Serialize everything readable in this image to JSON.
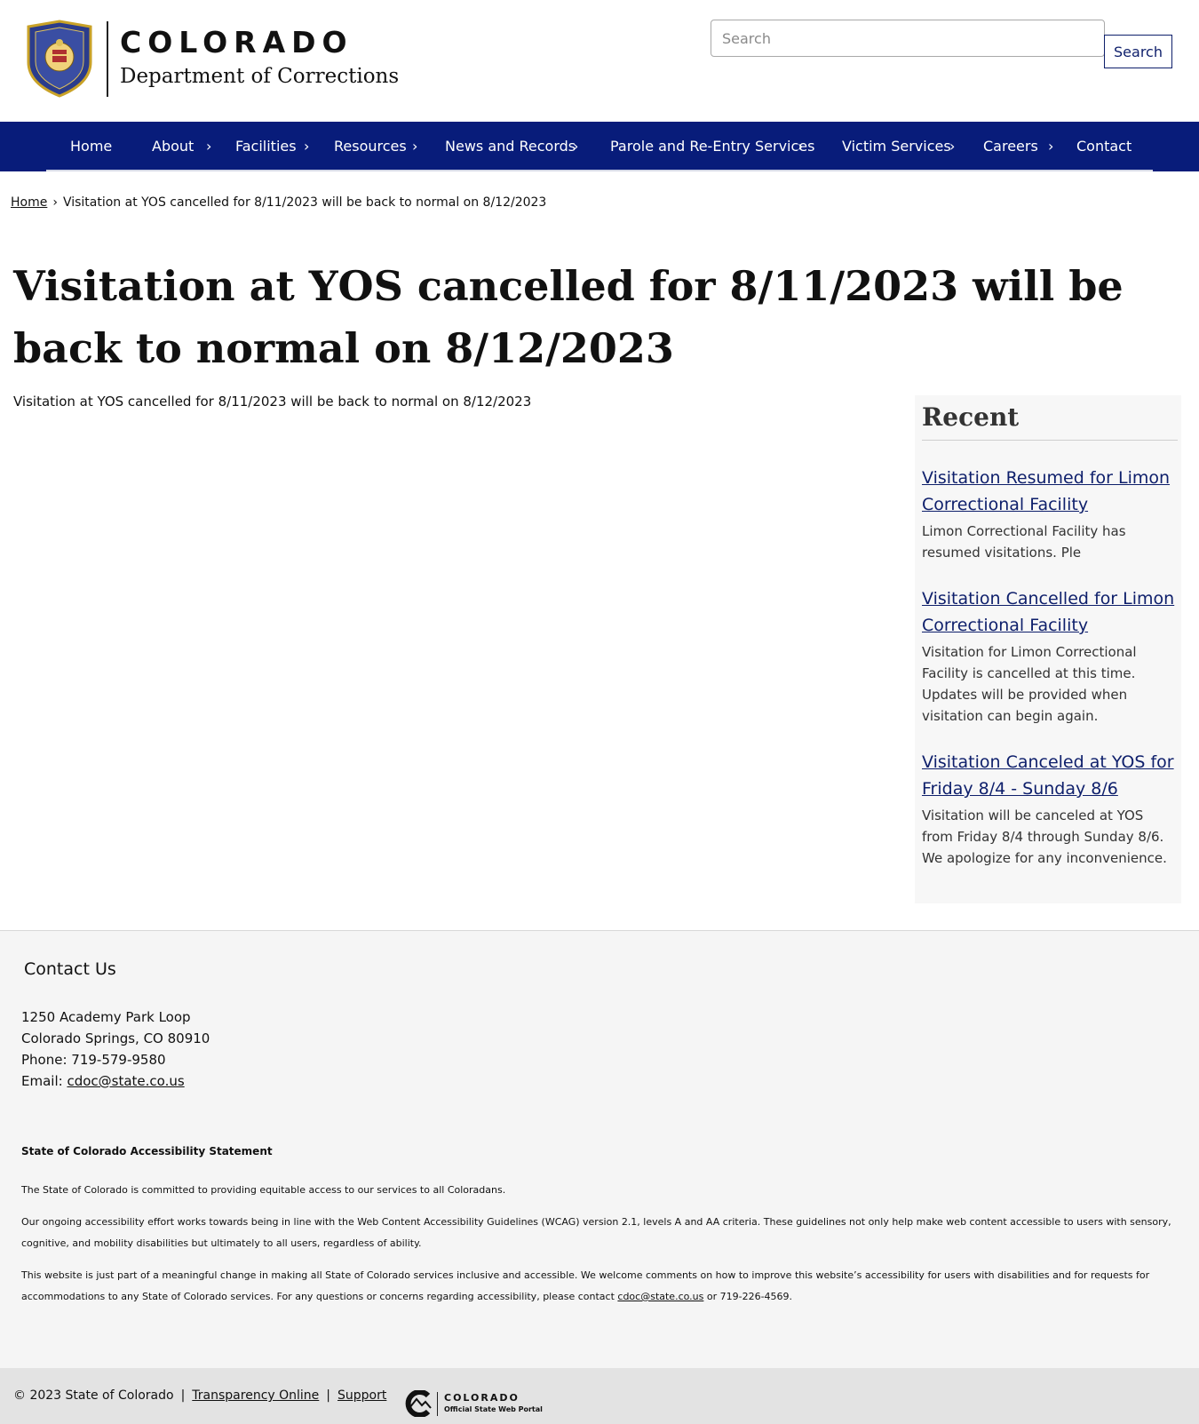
{
  "header": {
    "brand_name": "COLORADO",
    "department": "Department of Corrections",
    "search_placeholder": "Search",
    "search_button": "Search"
  },
  "nav": {
    "items": [
      {
        "label": "Home"
      },
      {
        "label": "About"
      },
      {
        "label": "Facilities"
      },
      {
        "label": "Resources"
      },
      {
        "label": "News and Records"
      },
      {
        "label": "Parole and Re-Entry Services"
      },
      {
        "label": "Victim Services"
      },
      {
        "label": "Careers"
      },
      {
        "label": "Contact"
      }
    ],
    "chevron": "›"
  },
  "breadcrumb": {
    "home": "Home",
    "separator": "›",
    "current": "Visitation at YOS cancelled for 8/11/2023 will be back to normal on 8/12/2023"
  },
  "article": {
    "title": "Visitation at YOS cancelled for 8/11/2023 will be back to normal on 8/12/2023",
    "body": "Visitation at YOS cancelled for 8/11/2023 will be back to normal on 8/12/2023"
  },
  "recent": {
    "heading": "Recent",
    "items": [
      {
        "title": "Visitation Resumed for Limon Correctional Facility",
        "desc": "Limon Correctional Facility has resumed visitations.  Ple"
      },
      {
        "title": "Visitation Cancelled for Limon Correctional Facility",
        "desc": "Visitation for Limon Correctional Facility is cancelled at this time. Updates will be provided when visitation can begin again."
      },
      {
        "title": "Visitation Canceled at YOS for Friday 8/4 - Sunday 8/6",
        "desc": "Visitation will be canceled at YOS from Friday 8/4 through Sunday 8/6.  We apologize for any inconvenience."
      }
    ]
  },
  "footer": {
    "contact_heading": "Contact Us",
    "address1": "1250 Academy Park Loop",
    "address2": "Colorado Springs, CO 80910",
    "phone": "Phone: 719-579-9580",
    "email_label": "Email: ",
    "email": "cdoc@state.co.us",
    "acc_heading": "State of Colorado Accessibility Statement",
    "acc_p1": "The State of Colorado is committed to providing equitable access to our services to all Coloradans.",
    "acc_p2": "Our ongoing accessibility effort works towards being in line with the Web Content Accessibility Guidelines (WCAG) version 2.1, levels A and AA criteria. These guidelines not only help make web content accessible to users with sensory, cognitive, and mobility disabilities but ultimately to all users, regardless of ability.",
    "acc_p3_start": "This website is just part of a meaningful change in making all State of Colorado services inclusive and accessible. We welcome comments on how to improve this website’s accessibility for users with disabilities and for requests for accommodations to any State of Colorado services. For any questions or concerns regarding accessibility, please contact ",
    "acc_p3_email": "cdoc@state.co.us",
    "acc_p3_end": " or 719-226-4569.",
    "copyright": "© 2023 State of Colorado",
    "pipe": "|",
    "transparency": "Transparency Online",
    "support": "Support",
    "portal_name": "COLORADO",
    "portal_sub": "Official State Web Portal"
  },
  "colors": {
    "nav_bg": "#081c7a",
    "link": "#0e1f6b"
  }
}
